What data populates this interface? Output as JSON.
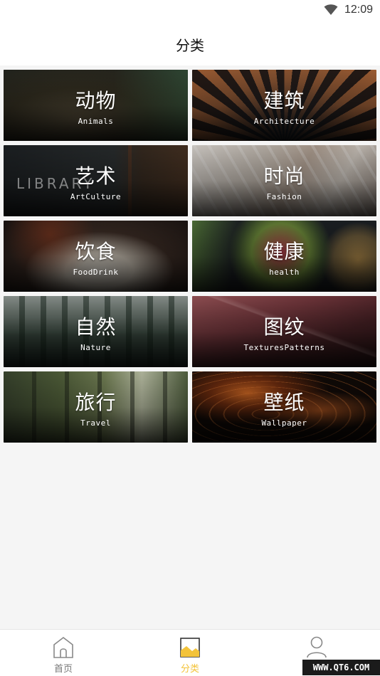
{
  "status_bar": {
    "time": "12:09",
    "wifi_icon": "wifi-icon"
  },
  "header": {
    "title": "分类"
  },
  "categories": [
    {
      "zh": "动物",
      "en": "Animals"
    },
    {
      "zh": "建筑",
      "en": "Architecture"
    },
    {
      "zh": "艺术",
      "en": "ArtCulture",
      "overlay_text": "LIBRARY"
    },
    {
      "zh": "时尚",
      "en": "Fashion"
    },
    {
      "zh": "饮食",
      "en": "FoodDrink"
    },
    {
      "zh": "健康",
      "en": "health"
    },
    {
      "zh": "自然",
      "en": "Nature"
    },
    {
      "zh": "图纹",
      "en": "TexturesPatterns"
    },
    {
      "zh": "旅行",
      "en": "Travel"
    },
    {
      "zh": "壁纸",
      "en": "Wallpaper"
    }
  ],
  "bottom_nav": [
    {
      "label": "首页",
      "icon": "home-icon",
      "active": false
    },
    {
      "label": "分类",
      "icon": "category-image-icon",
      "active": true
    },
    {
      "label": "",
      "icon": "profile-icon",
      "active": false
    }
  ],
  "watermark": "WWW.QT6.COM",
  "colors": {
    "accent": "#f3c33a",
    "background": "#f5f5f5"
  }
}
